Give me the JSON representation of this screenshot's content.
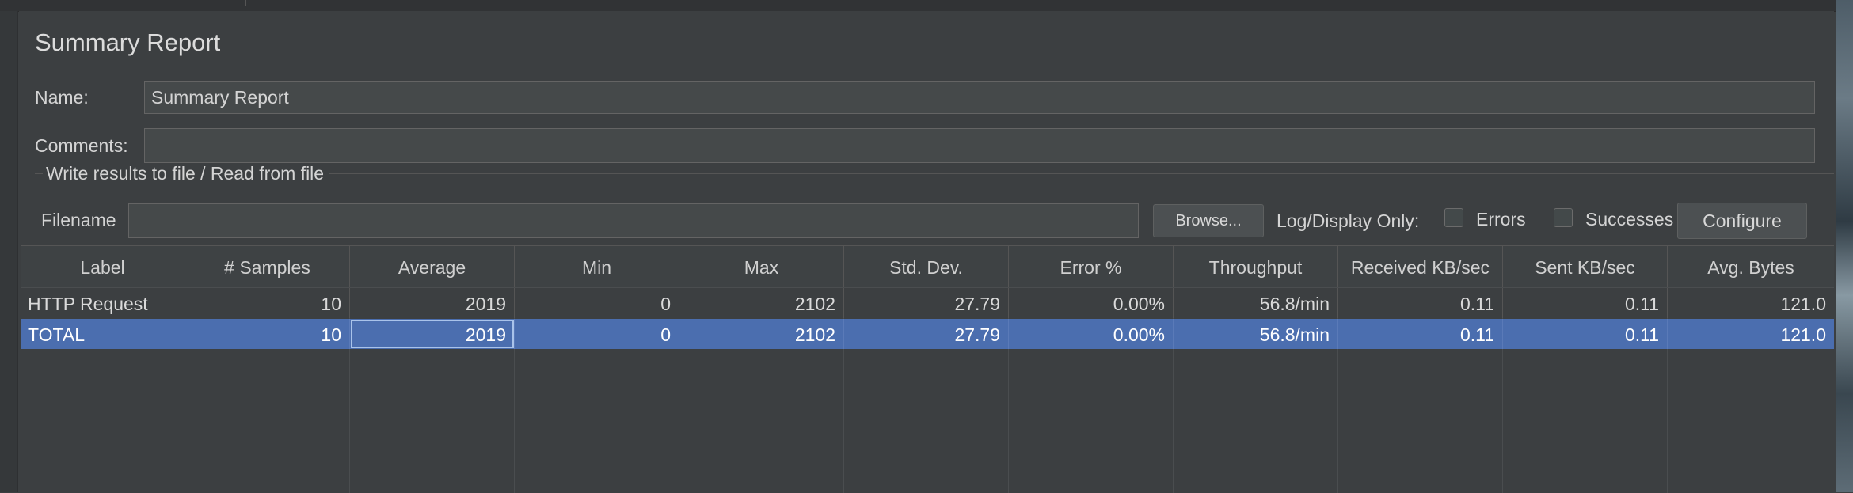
{
  "panel": {
    "title": "Summary Report",
    "name_label": "Name:",
    "name_value": "Summary Report",
    "comments_label": "Comments:",
    "comments_value": "",
    "file_group_title": "Write results to file / Read from file",
    "filename_label": "Filename",
    "filename_value": "",
    "browse_label": "Browse...",
    "log_display_label": "Log/Display Only:",
    "errors_label": "Errors",
    "successes_label": "Successes",
    "configure_label": "Configure"
  },
  "table": {
    "columns": [
      "Label",
      "# Samples",
      "Average",
      "Min",
      "Max",
      "Std. Dev.",
      "Error %",
      "Throughput",
      "Received KB/sec",
      "Sent KB/sec",
      "Avg. Bytes"
    ],
    "rows": [
      [
        "HTTP Request",
        "10",
        "2019",
        "0",
        "2102",
        "27.79",
        "0.00%",
        "56.8/min",
        "0.11",
        "0.11",
        "121.0"
      ],
      [
        "TOTAL",
        "10",
        "2019",
        "0",
        "2102",
        "27.79",
        "0.00%",
        "56.8/min",
        "0.11",
        "0.11",
        "121.0"
      ]
    ],
    "selected_row": 1
  }
}
